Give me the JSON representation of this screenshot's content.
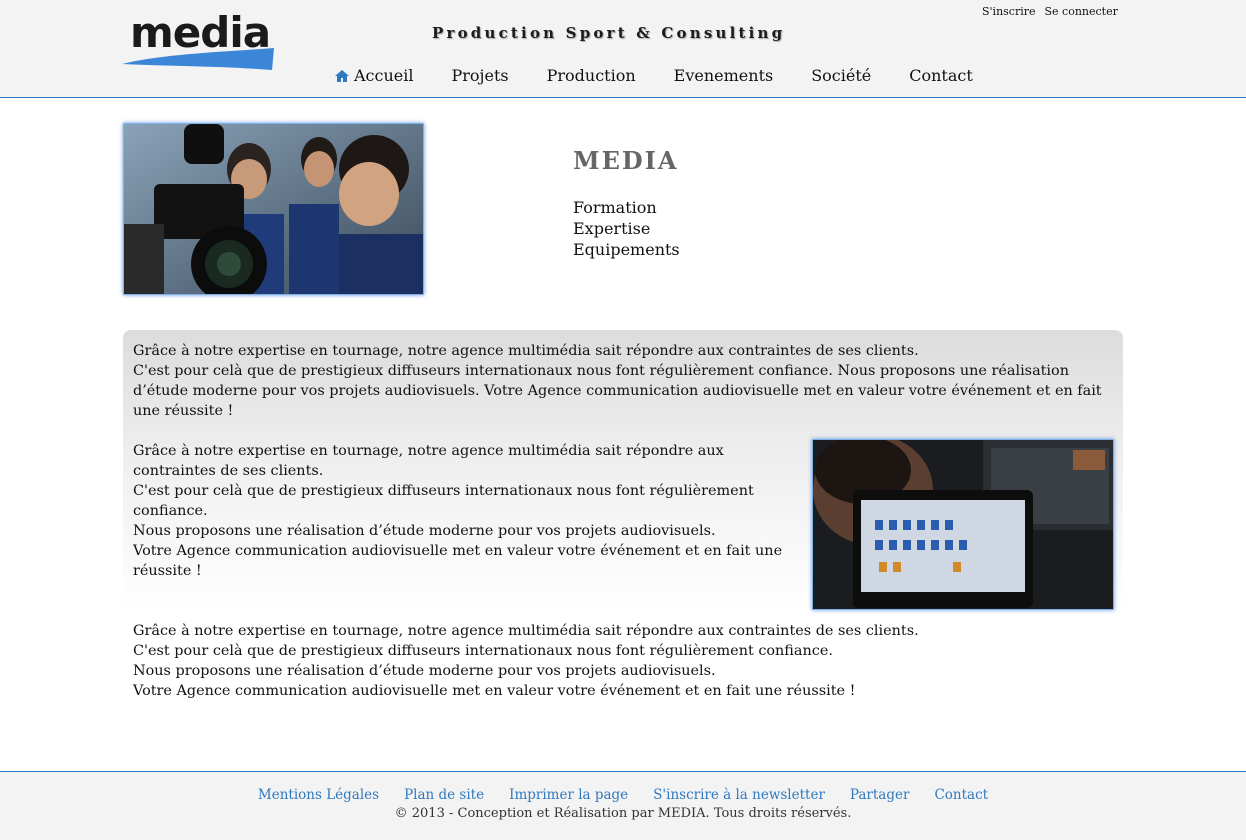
{
  "header": {
    "logo_text": "media",
    "tagline": "Production Sport & Consulting",
    "auth": {
      "signup": "S'inscrire",
      "login": "Se connecter"
    },
    "nav": [
      {
        "label": "Accueil",
        "icon": "home-icon"
      },
      {
        "label": "Projets"
      },
      {
        "label": "Production"
      },
      {
        "label": "Evenements"
      },
      {
        "label": "Société"
      },
      {
        "label": "Contact"
      }
    ]
  },
  "intro": {
    "title": "MEDIA",
    "items": [
      "Formation",
      "Expertise",
      "Equipements"
    ]
  },
  "content": {
    "para1": [
      "Grâce à notre expertise en tournage, notre agence multimédia sait répondre aux contraintes de ses clients.",
      "C'est pour celà que de prestigieux diffuseurs internationaux nous font régulièrement confiance. Nous proposons une réalisation d’étude moderne pour vos projets audiovisuels. Votre Agence communication audiovisuelle met en valeur votre événement et en fait une réussite !"
    ],
    "para2": [
      "Grâce à notre expertise en tournage, notre agence multimédia sait répondre aux contraintes de ses clients.",
      "C'est pour celà que de prestigieux diffuseurs internationaux nous font régulièrement confiance.",
      "Nous proposons une réalisation d’étude moderne pour vos projets audiovisuels.",
      "Votre Agence communication audiovisuelle met en valeur votre événement et en fait une réussite !"
    ],
    "para3": [
      "Grâce à notre expertise en tournage, notre agence multimédia sait répondre aux contraintes de ses clients.",
      "C'est pour celà que de prestigieux diffuseurs internationaux nous font régulièrement confiance.",
      "Nous proposons une réalisation d’étude moderne pour vos projets audiovisuels.",
      "Votre Agence communication audiovisuelle met en valeur votre événement et en fait une réussite !"
    ]
  },
  "footer": {
    "links": [
      "Mentions Légales",
      "Plan de site",
      "Imprimer la page",
      "S'inscrire à la newsletter",
      "Partager",
      "Contact"
    ],
    "copyright": "© 2013 - Conception et Réalisation par MEDIA. Tous droits réservés."
  },
  "colors": {
    "accent": "#2f79c0",
    "header_bg": "#f3f3f3"
  }
}
